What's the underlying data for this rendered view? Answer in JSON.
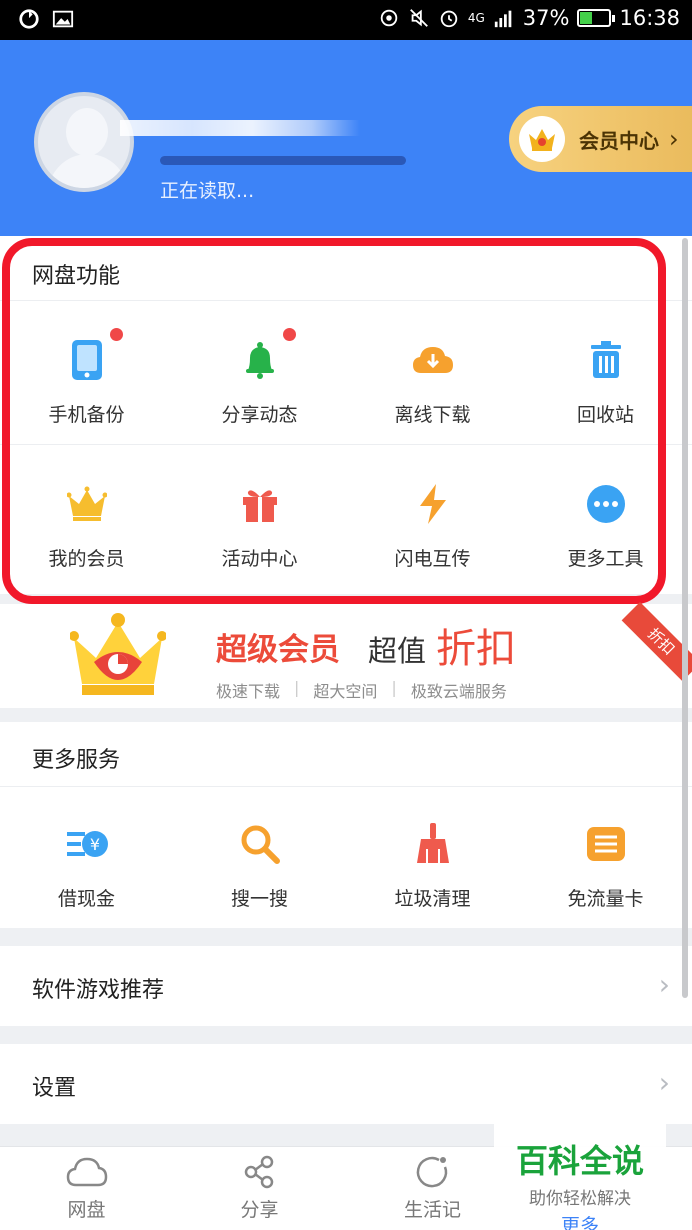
{
  "status_bar": {
    "battery": "37%",
    "time": "16:38",
    "network": "4G",
    "battery_level": 0.37
  },
  "header": {
    "loading_text": "正在读取...",
    "vip_center_label": "会员中心"
  },
  "netdisk": {
    "title": "网盘功能",
    "items": [
      {
        "label": "手机备份",
        "icon": "phone-icon",
        "badge": true
      },
      {
        "label": "分享动态",
        "icon": "bell-icon",
        "badge": true
      },
      {
        "label": "离线下载",
        "icon": "cloud-download-icon",
        "badge": false
      },
      {
        "label": "回收站",
        "icon": "trash-icon",
        "badge": false
      },
      {
        "label": "我的会员",
        "icon": "crown-icon",
        "badge": false
      },
      {
        "label": "活动中心",
        "icon": "gift-icon",
        "badge": false
      },
      {
        "label": "闪电互传",
        "icon": "lightning-icon",
        "badge": false
      },
      {
        "label": "更多工具",
        "icon": "more-icon",
        "badge": false
      }
    ]
  },
  "vip_banner": {
    "title": "超级会员",
    "value_text": "超值",
    "discount_text": "折扣",
    "ribbon": "折扣",
    "features": [
      "极速下载",
      "|",
      "超大空间",
      "|",
      "极致云端服务"
    ]
  },
  "more_services": {
    "title": "更多服务",
    "items": [
      {
        "label": "借现金",
        "icon": "cash-loan-icon"
      },
      {
        "label": "搜一搜",
        "icon": "search-icon"
      },
      {
        "label": "垃圾清理",
        "icon": "broom-icon"
      },
      {
        "label": "免流量卡",
        "icon": "data-card-icon"
      }
    ]
  },
  "rows": {
    "software_games": "软件游戏推荐",
    "settings": "设置"
  },
  "bottom_nav": {
    "items": [
      {
        "label": "网盘",
        "icon": "cloud-icon"
      },
      {
        "label": "分享",
        "icon": "share-icon"
      },
      {
        "label": "生活记",
        "icon": "life-icon"
      },
      {
        "label": "更多",
        "icon": "more-tab-icon"
      }
    ]
  },
  "watermark": {
    "title": "百科全说",
    "subtitle": "助你轻松解决"
  },
  "colors": {
    "brand_blue": "#3d83f7",
    "highlight_red": "#f1182a",
    "vip_gold": "#f2c86a"
  }
}
